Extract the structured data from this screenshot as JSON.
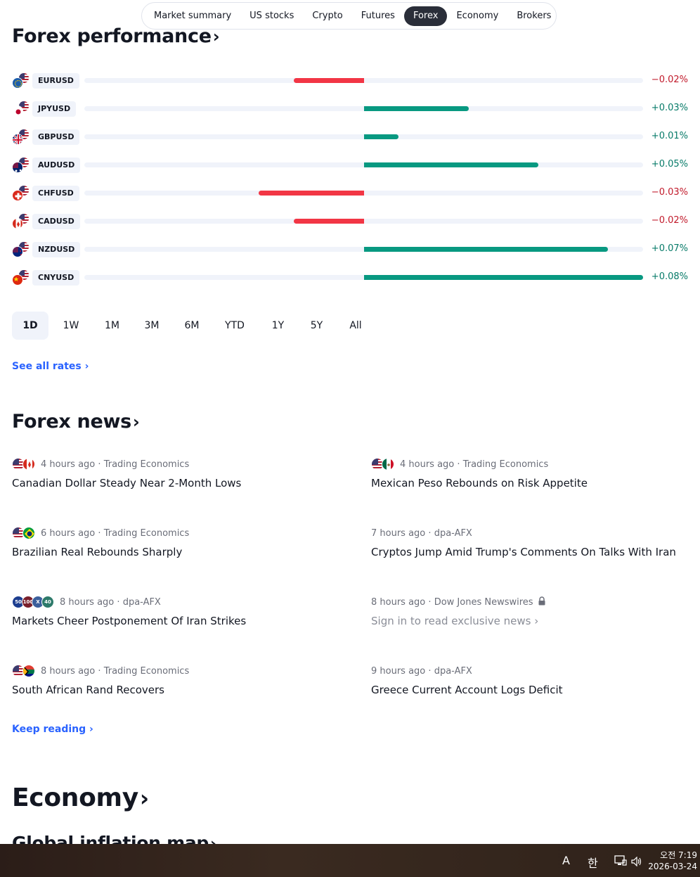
{
  "nav": {
    "tabs": [
      {
        "label": "Market summary",
        "active": false
      },
      {
        "label": "US stocks",
        "active": false
      },
      {
        "label": "Crypto",
        "active": false
      },
      {
        "label": "Futures",
        "active": false
      },
      {
        "label": "Forex",
        "active": true
      },
      {
        "label": "Economy",
        "active": false
      },
      {
        "label": "Brokers",
        "active": false
      }
    ]
  },
  "forex_performance": {
    "title": "Forex performance",
    "chevron": "›",
    "rows": [
      {
        "symbol": "EURUSD",
        "change": -0.02,
        "change_text": "−0.02%",
        "flags": [
          "eu-flag",
          "us-flag"
        ]
      },
      {
        "symbol": "JPYUSD",
        "change": 0.03,
        "change_text": "+0.03%",
        "flags": [
          "jp-flag",
          "us-flag"
        ]
      },
      {
        "symbol": "GBPUSD",
        "change": 0.01,
        "change_text": "+0.01%",
        "flags": [
          "gb-flag",
          "us-flag"
        ]
      },
      {
        "symbol": "AUDUSD",
        "change": 0.05,
        "change_text": "+0.05%",
        "flags": [
          "au-flag",
          "us-flag"
        ]
      },
      {
        "symbol": "CHFUSD",
        "change": -0.03,
        "change_text": "−0.03%",
        "flags": [
          "ch-flag",
          "us-flag"
        ]
      },
      {
        "symbol": "CADUSD",
        "change": -0.02,
        "change_text": "−0.02%",
        "flags": [
          "ca-flag",
          "us-flag"
        ]
      },
      {
        "symbol": "NZDUSD",
        "change": 0.07,
        "change_text": "+0.07%",
        "flags": [
          "nz-flag",
          "us-flag"
        ]
      },
      {
        "symbol": "CNYUSD",
        "change": 0.08,
        "change_text": "+0.08%",
        "flags": [
          "cn-flag",
          "us-flag"
        ]
      }
    ],
    "scale_max": 0.08,
    "colors": {
      "negative": "#f23645",
      "positive": "#089981",
      "negative_text": "#c1192a",
      "positive_text": "#067a68"
    },
    "ranges": [
      {
        "label": "1D",
        "active": true
      },
      {
        "label": "1W",
        "active": false
      },
      {
        "label": "1M",
        "active": false
      },
      {
        "label": "3M",
        "active": false
      },
      {
        "label": "6M",
        "active": false
      },
      {
        "label": "YTD",
        "active": false
      },
      {
        "label": "1Y",
        "active": false
      },
      {
        "label": "5Y",
        "active": false
      },
      {
        "label": "All",
        "active": false
      }
    ],
    "see_all": "See all rates",
    "see_all_chevron": "›"
  },
  "forex_news": {
    "title": "Forex news",
    "chevron": "›",
    "items": [
      {
        "time": "4 hours ago",
        "source": "Trading Economics",
        "title": "Canadian Dollar Steady Near 2-Month Lows",
        "flags": [
          "us-flag",
          "ca-flag"
        ]
      },
      {
        "time": "4 hours ago",
        "source": "Trading Economics",
        "title": "Mexican Peso Rebounds on Risk Appetite",
        "flags": [
          "us-flag",
          "mx-flag"
        ]
      },
      {
        "time": "6 hours ago",
        "source": "Trading Economics",
        "title": "Brazilian Real Rebounds Sharply",
        "flags": [
          "us-flag",
          "br-flag"
        ]
      },
      {
        "time": "7 hours ago",
        "source": "dpa-AFX",
        "title": "Cryptos Jump Amid Trump's Comments On Talks With Iran",
        "flags": []
      },
      {
        "time": "8 hours ago",
        "source": "dpa-AFX",
        "title": "Markets Cheer Postponement Of Iran Strikes",
        "badges": [
          "50",
          "100",
          "X",
          "40"
        ]
      },
      {
        "time": "8 hours ago",
        "source": "Dow Jones Newswires",
        "title": "Sign in to read exclusive news",
        "locked": true,
        "title_chevron": "›"
      },
      {
        "time": "8 hours ago",
        "source": "Trading Economics",
        "title": "South African Rand Recovers",
        "flags": [
          "us-flag",
          "za-flag"
        ]
      },
      {
        "time": "9 hours ago",
        "source": "dpa-AFX",
        "title": "Greece Current Account Logs Deficit",
        "flags": []
      }
    ],
    "separator": "·",
    "keep_reading": "Keep reading",
    "keep_reading_chevron": "›"
  },
  "economy": {
    "title": "Economy",
    "chevron": "›",
    "subtitle": "Global inflation map",
    "subtitle_chevron": "›"
  },
  "taskbar": {
    "ime_a": "A",
    "ime_han": "한",
    "time": "오전 7:19",
    "date": "2026-03-24",
    "icons": [
      "network-icon",
      "volume-icon"
    ]
  }
}
